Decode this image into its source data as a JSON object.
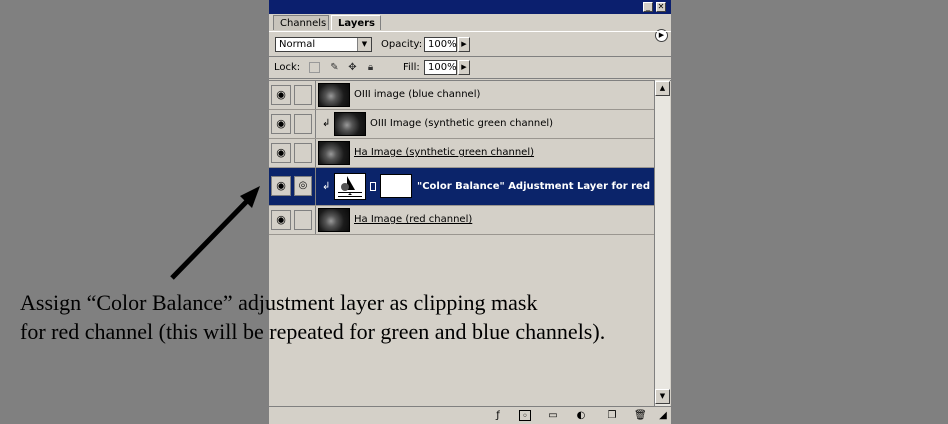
{
  "tabs": [
    {
      "label": "Channels"
    },
    {
      "label": "Layers"
    }
  ],
  "options": {
    "blend_mode": "Normal",
    "opacity_label": "Opacity:",
    "opacity_value": "100%",
    "lock_label": "Lock:",
    "fill_label": "Fill:",
    "fill_value": "100%"
  },
  "layers": [
    {
      "name": "OIII image (blue channel)",
      "visible": true,
      "clipped": false,
      "selected": false
    },
    {
      "name": "OIII Image (synthetic green channel)",
      "visible": true,
      "clipped": true,
      "selected": false
    },
    {
      "name": "Ha Image (synthetic green channel)",
      "visible": true,
      "clipped": false,
      "selected": false,
      "underlined": true
    },
    {
      "name": "\"Color Balance\" Adjustment Layer for red",
      "visible": true,
      "clipped": true,
      "selected": true,
      "type": "adjustment"
    },
    {
      "name": "Ha Image (red channel)",
      "visible": true,
      "clipped": false,
      "selected": false,
      "underlined": true
    }
  ],
  "caption": {
    "line1": "Assign “Color Balance” adjustment layer as clipping mask",
    "line2": "for red channel (this will be repeated for green and blue channels)."
  },
  "colors": {
    "selection": "#0b246a",
    "panel": "#d4d0c8",
    "background": "#808080"
  }
}
